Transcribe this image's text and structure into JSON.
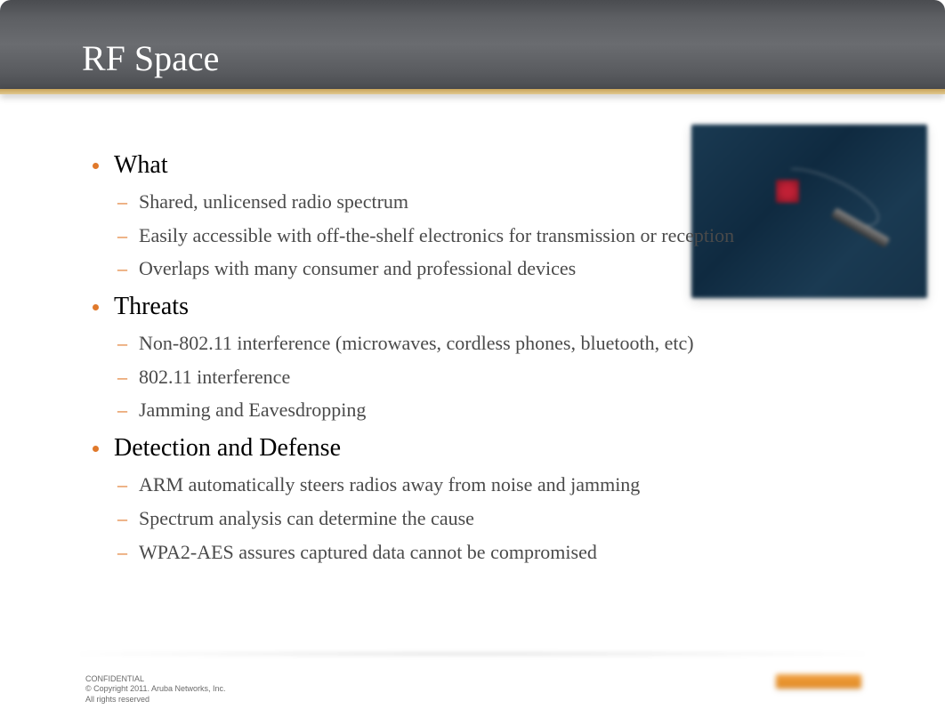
{
  "title": "RF Space",
  "sections": [
    {
      "heading": "What",
      "items": [
        "Shared, unlicensed radio spectrum",
        "Easily accessible with off-the-shelf electronics for transmission or reception",
        "Overlaps with many consumer and professional devices"
      ]
    },
    {
      "heading": "Threats",
      "items": [
        "Non-802.11 interference (microwaves, cordless phones, bluetooth, etc)",
        "802.11 interference",
        "Jamming and Eavesdropping"
      ]
    },
    {
      "heading": "Detection and Defense",
      "items": [
        "ARM automatically steers radios away from noise and jamming",
        "Spectrum analysis can determine the cause",
        "WPA2-AES assures captured data cannot be compromised"
      ]
    }
  ],
  "footer": {
    "line1": "CONFIDENTIAL",
    "line2": "© Copyright 2011. Aruba Networks, Inc.",
    "line3": "All rights reserved"
  }
}
